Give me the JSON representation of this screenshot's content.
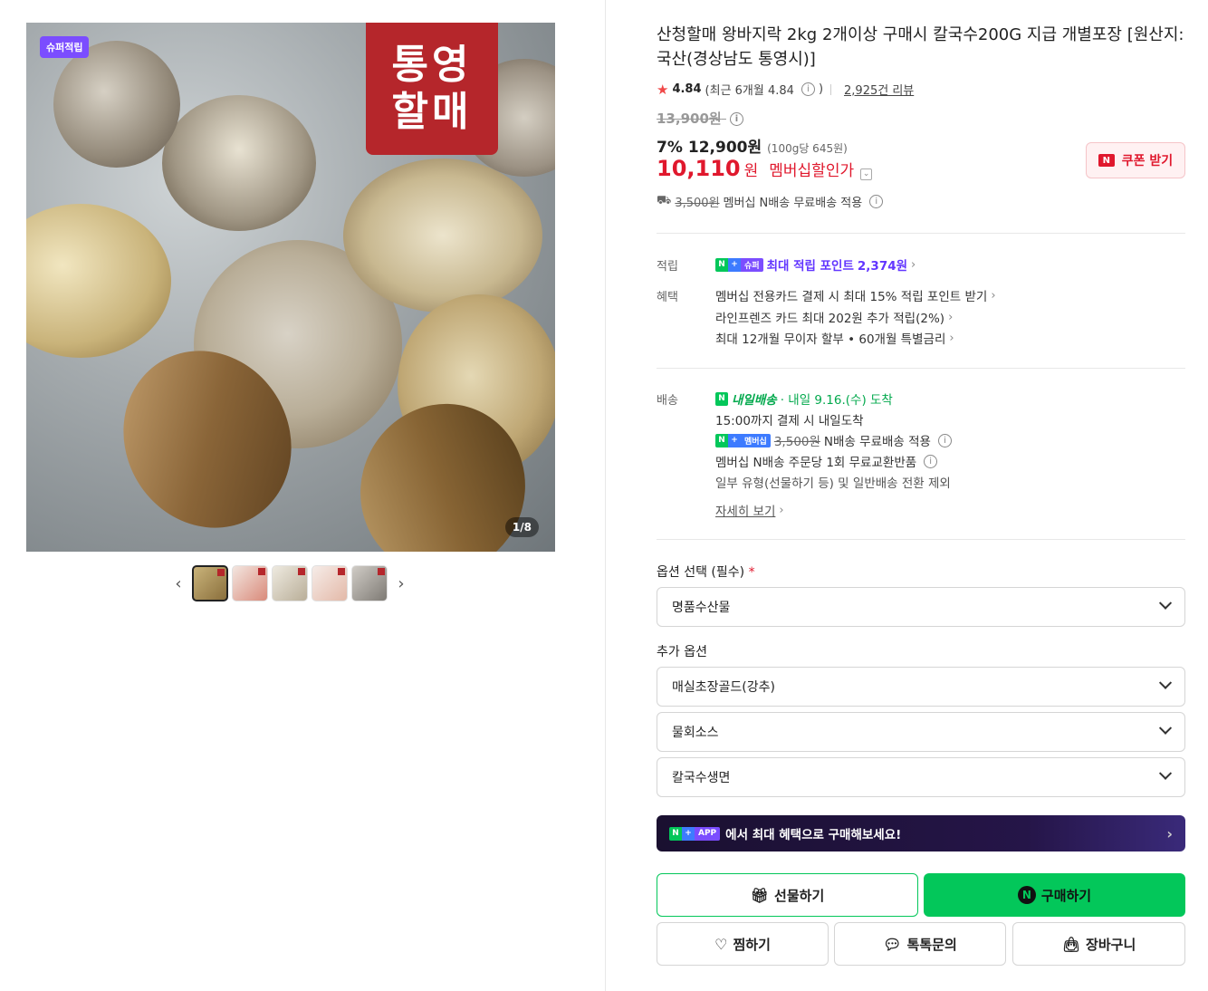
{
  "gallery": {
    "super_badge": "슈퍼적립",
    "brand_line1": "통영",
    "brand_line2": "할매",
    "counter": "1/8",
    "prev_icon": "chevron-left-icon",
    "next_icon": "chevron-right-icon",
    "thumbnail_count": 5,
    "active_thumbnail": 1
  },
  "product": {
    "title": "산청할매 왕바지락 2kg 2개이상 구매시 칼국수200G 지급 개별포장 [원산지:국산(경상남도 통영시)]",
    "rating": "4.84",
    "recent_rating": "(최근 6개월 4.84",
    "recent_rating_close": ")",
    "review_count": "2,925건 리뷰",
    "original_price": "13,900원",
    "discount_rate": "7%",
    "sale_price": "12,900원",
    "unit_price": "(100g당 645원)",
    "member_price": "10,110",
    "member_won": "원",
    "member_label": "멤버십할인가",
    "coupon_label": "쿠폰 받기",
    "shipping_strike": "3,500원",
    "shipping_text": "멤버십 N배송 무료배송 적용"
  },
  "points": {
    "label": "적립",
    "chip_super": "슈퍼",
    "text": "최대 적립 포인트",
    "amount": "2,374원"
  },
  "benefits": {
    "label": "혜택",
    "lines": [
      "멤버십 전용카드 결제 시 최대 15% 적립 포인트 받기",
      "라인프렌즈 카드 최대 202원 추가 적립(2%)",
      "최대 12개월 무이자 할부 • 60개월 특별금리"
    ]
  },
  "delivery": {
    "label": "배송",
    "tomorrow_badge": "내일배송",
    "arrival": "· 내일 9.16.(수) 도착",
    "cutoff": "15:00까지 결제 시 내일도착",
    "member_chip": "멤버십",
    "strike_fee": "3,500원",
    "free_text": "N배송 무료배송 적용",
    "exchange": "멤버십 N배송 주문당 1회 무료교환반품",
    "exclusion": "일부 유형(선물하기 등) 및 일반배송 전환 제외",
    "more_link": "자세히 보기"
  },
  "options": {
    "required_label": "옵션 선택 (필수)",
    "required_mark": "*",
    "required_value": "명품수산물",
    "extra_label": "추가 옵션",
    "extra_values": [
      "매실초장골드(강추)",
      "물회소스",
      "칼국수생면"
    ]
  },
  "app_banner": {
    "chip_app": "APP",
    "text": "에서 최대 혜택으로 구매해보세요!"
  },
  "actions": {
    "gift": "선물하기",
    "buy": "구매하기",
    "wish": "찜하기",
    "talk": "톡톡문의",
    "cart": "장바구니"
  },
  "colors": {
    "naver_green": "#03c75a",
    "member_red": "#e0182d",
    "super_purple": "#7b4dff",
    "brand_red": "#b5262b"
  }
}
